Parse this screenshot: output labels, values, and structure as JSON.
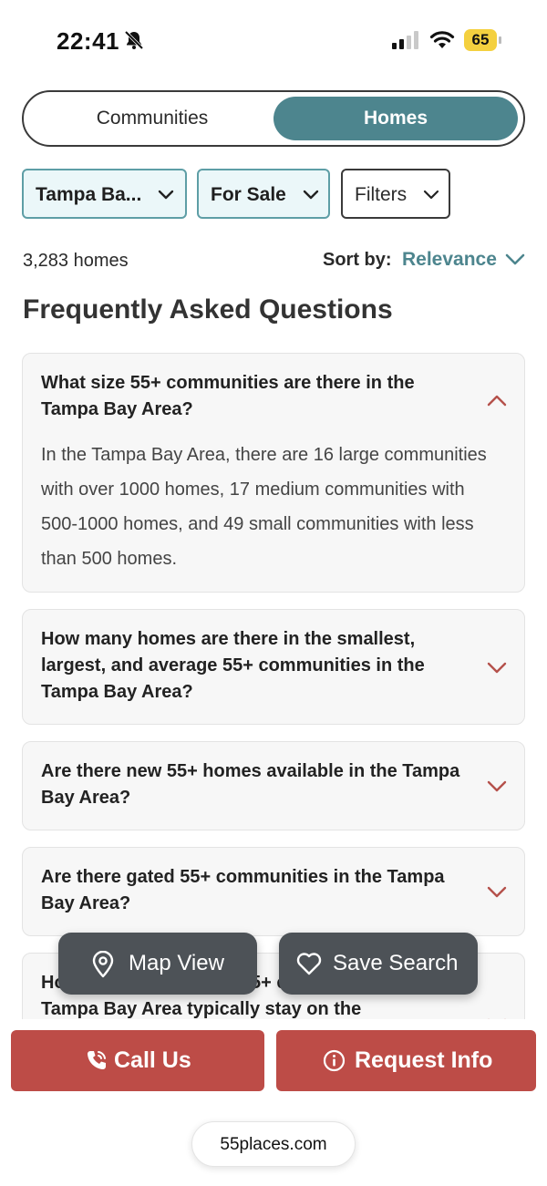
{
  "status_bar": {
    "time": "22:41",
    "battery": "65",
    "icons": [
      "bell-slash-icon",
      "cellular-signal-icon",
      "wifi-icon",
      "battery-icon"
    ]
  },
  "toggle": {
    "communities": "Communities",
    "homes": "Homes",
    "active": "Homes"
  },
  "filters": {
    "location": "Tampa Ba...",
    "listing_type": "For Sale",
    "filters": "Filters"
  },
  "results": {
    "count": "3,283 homes",
    "sort_label": "Sort by:",
    "sort_value": "Relevance"
  },
  "faq": {
    "title": "Frequently Asked Questions",
    "items": [
      {
        "question": "What size 55+ communities are there in the Tampa Bay Area?",
        "answer": "In the Tampa Bay Area, there are 16 large communities with over 1000 homes, 17 medium communities with 500-1000 homes, and 49 small communities with less than 500 homes.",
        "expanded": true
      },
      {
        "question": "How many homes are there in the smallest, largest, and average 55+ communities in the Tampa Bay Area?",
        "expanded": false
      },
      {
        "question": "Are there new 55+ homes available in the Tampa Bay Area?",
        "expanded": false
      },
      {
        "question": "Are there gated 55+ communities in the Tampa Bay Area?",
        "expanded": false
      },
      {
        "question": "How long do homes in 55+ communities in the Tampa Bay Area typically stay on the",
        "expanded": false
      }
    ]
  },
  "floating": {
    "map_view": "Map View",
    "save_search": "Save Search"
  },
  "cta": {
    "call_us": "Call Us",
    "request_info": "Request Info"
  },
  "browser": {
    "url": "55places.com"
  },
  "colors": {
    "teal": "#4d858e",
    "red": "#bd4c47",
    "float_gray": "#4d5257",
    "chevron_red": "#b5514b"
  }
}
